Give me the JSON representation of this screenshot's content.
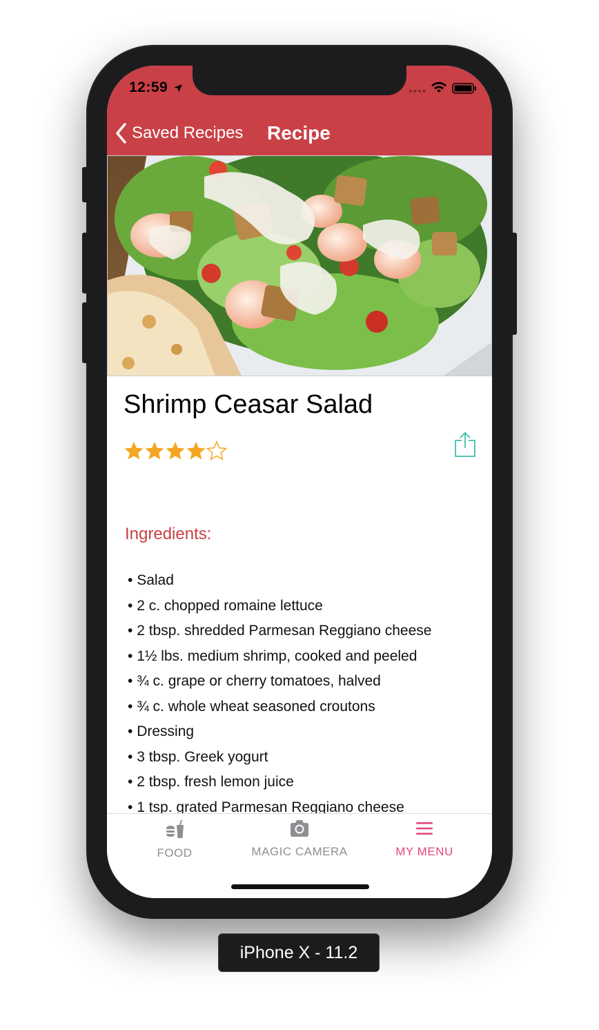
{
  "status_bar": {
    "time": "12:59"
  },
  "nav": {
    "back_label": "Saved Recipes",
    "title": "Recipe"
  },
  "recipe": {
    "title": "Shrimp Ceasar Salad",
    "rating": 4,
    "rating_max": 5,
    "ingredients_heading": "Ingredients:",
    "ingredients": [
      "Salad",
      "2 c. chopped romaine lettuce",
      "2 tbsp. shredded Parmesan Reggiano cheese",
      "1½ lbs. medium shrimp, cooked and peeled",
      "¾ c. grape or cherry tomatoes, halved",
      "¾ c. whole wheat seasoned croutons",
      "Dressing",
      "3 tbsp. Greek yogurt",
      "2 tbsp. fresh lemon juice",
      "1 tsp. grated Parmesan Reggiano cheese"
    ]
  },
  "tabs": [
    {
      "label": "FOOD",
      "icon": "food-icon",
      "active": false
    },
    {
      "label": "MAGIC CAMERA",
      "icon": "camera-icon",
      "active": false
    },
    {
      "label": "MY MENU",
      "icon": "menu-icon",
      "active": true
    }
  ],
  "device_label": "iPhone X - 11.2",
  "colors": {
    "header": "#c94046",
    "accent_heading": "#c94046",
    "star": "#f5a623",
    "share": "#3cbfae",
    "tab_active": "#e6457a",
    "tab_inactive": "#8e8e93"
  }
}
